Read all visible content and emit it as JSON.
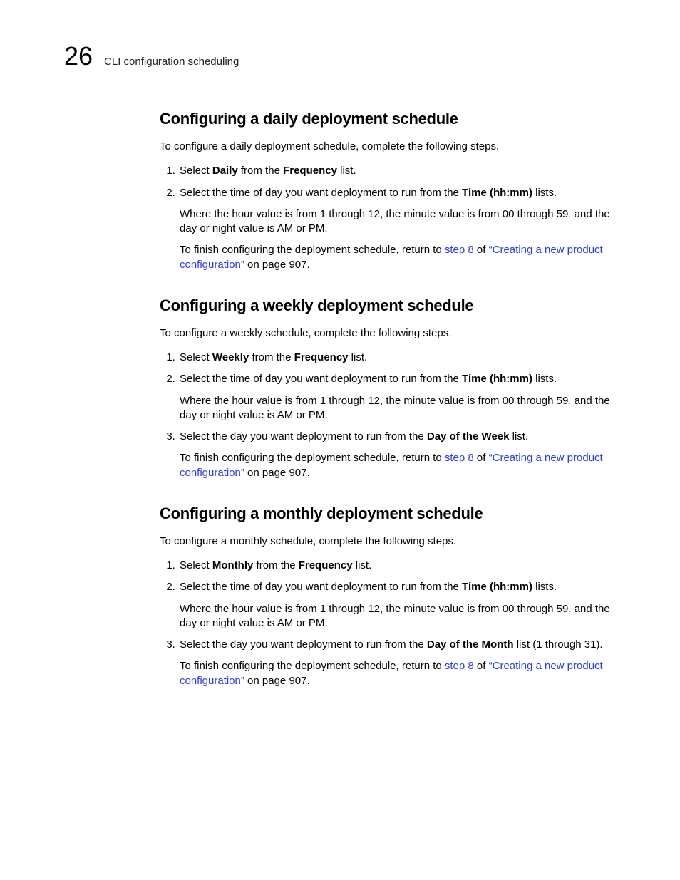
{
  "header": {
    "chapter": "26",
    "title": "CLI configuration scheduling"
  },
  "sections": [
    {
      "heading": "Configuring a daily deployment schedule",
      "intro": "To configure a daily deployment schedule, complete the following steps.",
      "steps": [
        {
          "pre": "Select ",
          "bold1": "Daily",
          "mid": " from the ",
          "bold2": "Frequency",
          "post": " list."
        },
        {
          "pre": "Select the time of day you want deployment to run from the ",
          "bold1": "Time (hh:mm)",
          "post": " lists.",
          "sub1": "Where the hour value is from 1 through 12, the minute value is from 00 through 59, and the day or night value is AM or PM.",
          "sub2_pre": "To finish configuring the deployment schedule, return to ",
          "sub2_link1": "step 8",
          "sub2_mid": " of ",
          "sub2_link2": "“Creating a new product configuration”",
          "sub2_post": " on page 907."
        }
      ]
    },
    {
      "heading": "Configuring a weekly deployment schedule",
      "intro": "To configure a weekly schedule, complete the following steps.",
      "steps": [
        {
          "pre": "Select ",
          "bold1": "Weekly",
          "mid": " from the ",
          "bold2": "Frequency",
          "post": " list."
        },
        {
          "pre": "Select the time of day you want deployment to run from the ",
          "bold1": "Time (hh:mm)",
          "post": " lists.",
          "sub1": "Where the hour value is from 1 through 12, the minute value is from 00 through 59, and the day or night value is AM or PM."
        },
        {
          "pre": "Select the day you want deployment to run from the ",
          "bold1": "Day of the Week",
          "post": " list.",
          "sub2_pre": "To finish configuring the deployment schedule, return to ",
          "sub2_link1": "step 8",
          "sub2_mid": " of ",
          "sub2_link2": "“Creating a new product configuration”",
          "sub2_post": " on page 907."
        }
      ]
    },
    {
      "heading": "Configuring a monthly deployment schedule",
      "intro": "To configure a monthly schedule, complete the following steps.",
      "steps": [
        {
          "pre": "Select ",
          "bold1": "Monthly",
          "mid": " from the ",
          "bold2": "Frequency",
          "post": " list."
        },
        {
          "pre": "Select the time of day you want deployment to run from the ",
          "bold1": "Time (hh:mm)",
          "post": " lists.",
          "sub1": "Where the hour value is from 1 through 12, the minute value is from 00 through 59, and the day or night value is AM or PM."
        },
        {
          "pre": "Select the day you want deployment to run from the ",
          "bold1": "Day of the Month",
          "post": " list (1 through 31).",
          "sub2_pre": "To finish configuring the deployment schedule, return to ",
          "sub2_link1": "step 8",
          "sub2_mid": " of ",
          "sub2_link2": "“Creating a new product configuration”",
          "sub2_post": " on page 907."
        }
      ]
    }
  ]
}
